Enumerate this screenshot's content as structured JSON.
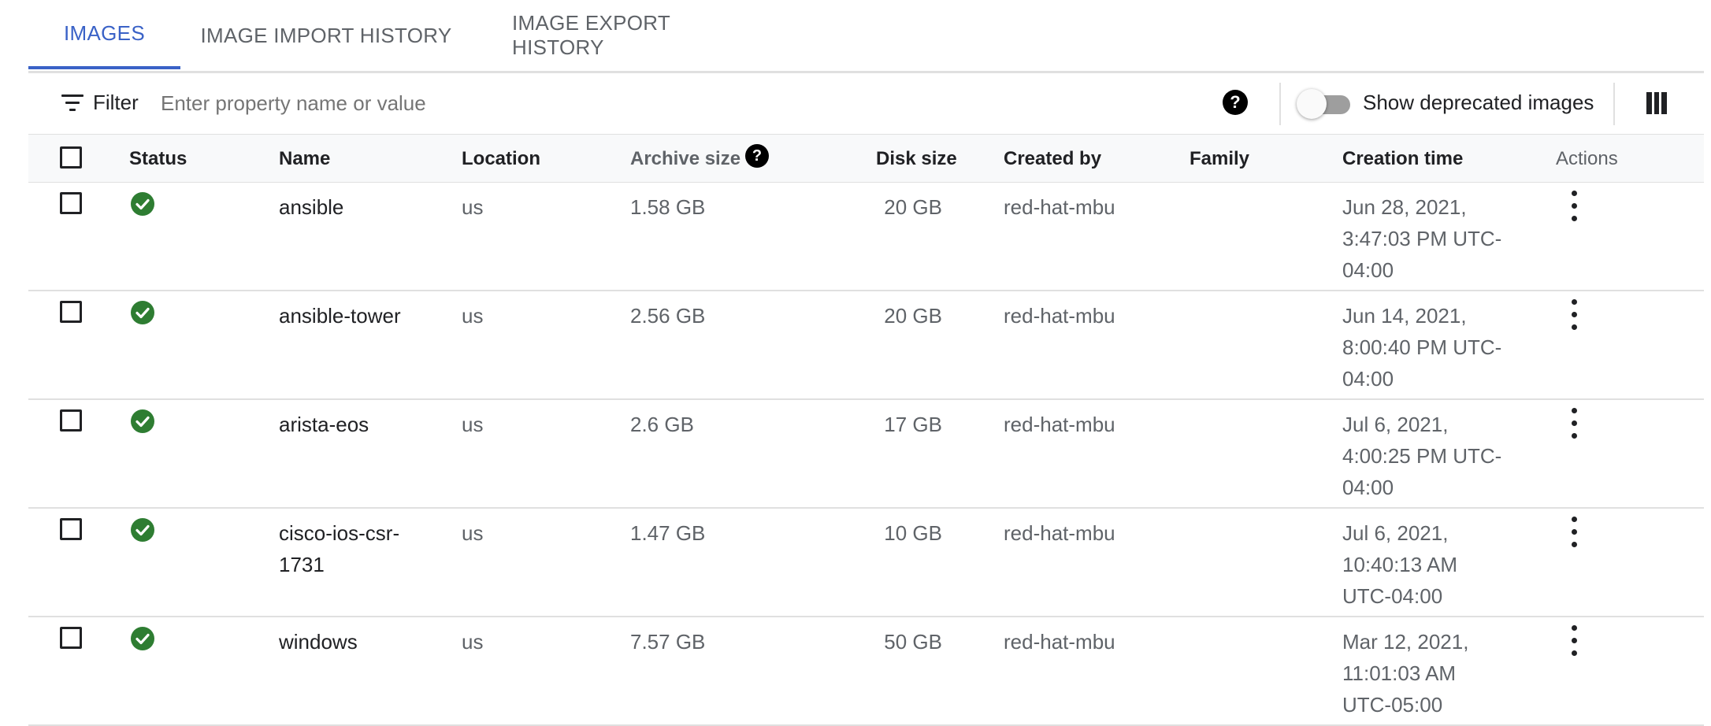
{
  "tabs": [
    {
      "label": "IMAGES",
      "active": true
    },
    {
      "label": "IMAGE IMPORT HISTORY",
      "active": false
    },
    {
      "label": "IMAGE EXPORT HISTORY",
      "active": false
    }
  ],
  "filter": {
    "label": "Filter",
    "placeholder": "Enter property name or value",
    "help_glyph": "?"
  },
  "toggle": {
    "label": "Show deprecated images",
    "on": false
  },
  "columns": {
    "status": "Status",
    "name": "Name",
    "location": "Location",
    "archive_size": "Archive size",
    "disk_size": "Disk size",
    "created_by": "Created by",
    "family": "Family",
    "creation_time": "Creation time",
    "actions": "Actions"
  },
  "rows": [
    {
      "name": [
        "ansible"
      ],
      "location": "us",
      "archive_size": "1.58 GB",
      "disk_size": "20 GB",
      "created_by": "red-hat-mbu",
      "family": "",
      "creation_time": [
        "Jun 28, 2021,",
        "3:47:03 PM UTC-",
        "04:00"
      ],
      "status": "ok"
    },
    {
      "name": [
        "ansible-tower"
      ],
      "location": "us",
      "archive_size": "2.56 GB",
      "disk_size": "20 GB",
      "created_by": "red-hat-mbu",
      "family": "",
      "creation_time": [
        "Jun 14, 2021,",
        "8:00:40 PM UTC-",
        "04:00"
      ],
      "status": "ok"
    },
    {
      "name": [
        "arista-eos"
      ],
      "location": "us",
      "archive_size": "2.6 GB",
      "disk_size": "17 GB",
      "created_by": "red-hat-mbu",
      "family": "",
      "creation_time": [
        "Jul 6, 2021,",
        "4:00:25 PM UTC-",
        "04:00"
      ],
      "status": "ok"
    },
    {
      "name": [
        "cisco-ios-csr-",
        "1731"
      ],
      "location": "us",
      "archive_size": "1.47 GB",
      "disk_size": "10 GB",
      "created_by": "red-hat-mbu",
      "family": "",
      "creation_time": [
        "Jul 6, 2021,",
        "10:40:13 AM",
        "UTC-04:00"
      ],
      "status": "ok"
    },
    {
      "name": [
        "windows"
      ],
      "location": "us",
      "archive_size": "7.57 GB",
      "disk_size": "50 GB",
      "created_by": "red-hat-mbu",
      "family": "",
      "creation_time": [
        "Mar 12, 2021,",
        "11:01:03 AM",
        "UTC-05:00"
      ],
      "status": "ok"
    }
  ],
  "colors": {
    "accent": "#3a62c7",
    "status_ok": "#2e7d32"
  },
  "icons": {
    "filter": "filter-list-icon",
    "help": "help-icon",
    "columns": "column-display-icon",
    "status_ok": "check-circle-icon",
    "row_actions": "more-vert-icon"
  }
}
